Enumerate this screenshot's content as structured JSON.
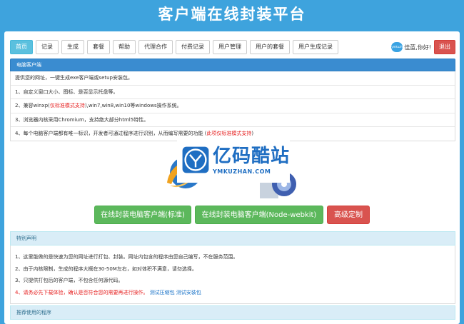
{
  "site": {
    "title": "客户端在线封装平台"
  },
  "nav": {
    "items": [
      "首页",
      "记录",
      "生成",
      "套餐",
      "帮助",
      "代理合作",
      "付费记录",
      "用户管理",
      "用户的套餐",
      "用户生成记录"
    ],
    "active_index": 0
  },
  "user": {
    "avatar_text": "ymkuzhan",
    "greeting": "佳蓝,你好!",
    "logout_label": "退出"
  },
  "desktop_card": {
    "title": "电脑客户端",
    "rows": [
      {
        "text": "提供您的网址，一键生成exe客户端或setup安装包。"
      },
      {
        "text": "1、自定义窗口大小、图标、是否显示托盘等。"
      },
      {
        "prefix": "2、兼容winxp(",
        "highlight": "仅标准模式支持",
        "suffix": "),win7,win8,win10等windows操作系统。"
      },
      {
        "text": "3、浏览器内核采用Chromium，支持绝大部分html5特性。"
      },
      {
        "prefix": "4、每个电脑客户端都有唯一标识，开发者可通过程序进行识别，从而编写需要的功能 (",
        "highlight": "此项仅标准模式支持",
        "suffix": ")"
      }
    ]
  },
  "watermark": {
    "name": "亿码酷站",
    "url": "YMKUZHAN.COM"
  },
  "actions": {
    "standard_label": "在线封装电脑客户端(标准)",
    "webkit_label": "在线封装电脑客户端(Node-webkit)",
    "custom_label": "高级定制"
  },
  "notice": {
    "title": "特别声明",
    "lines": [
      "1、这里能做的是快速为您的网址进行打包、封装。网址内包含的程序由您自己编写，不在服务范围。",
      "2、由于内核限制，生成的程序大概在30-50M左右，如对体积不满意，请勿选择。",
      "3、只提供打包后的客户端，不包含任何源代码。"
    ],
    "warning": "4、请务必先下载体验，确认是否符合您的需要再进行操作。",
    "test_zip_label": "测试压缩包",
    "test_setup_label": "测试安装包"
  },
  "recommend": {
    "title": "推荐使用的程序"
  },
  "colors": {
    "background": "#3ea3dd",
    "header_blue": "#3a8cd0",
    "green": "#5cb85c",
    "red": "#d9534f",
    "info": "#d9edf7"
  }
}
